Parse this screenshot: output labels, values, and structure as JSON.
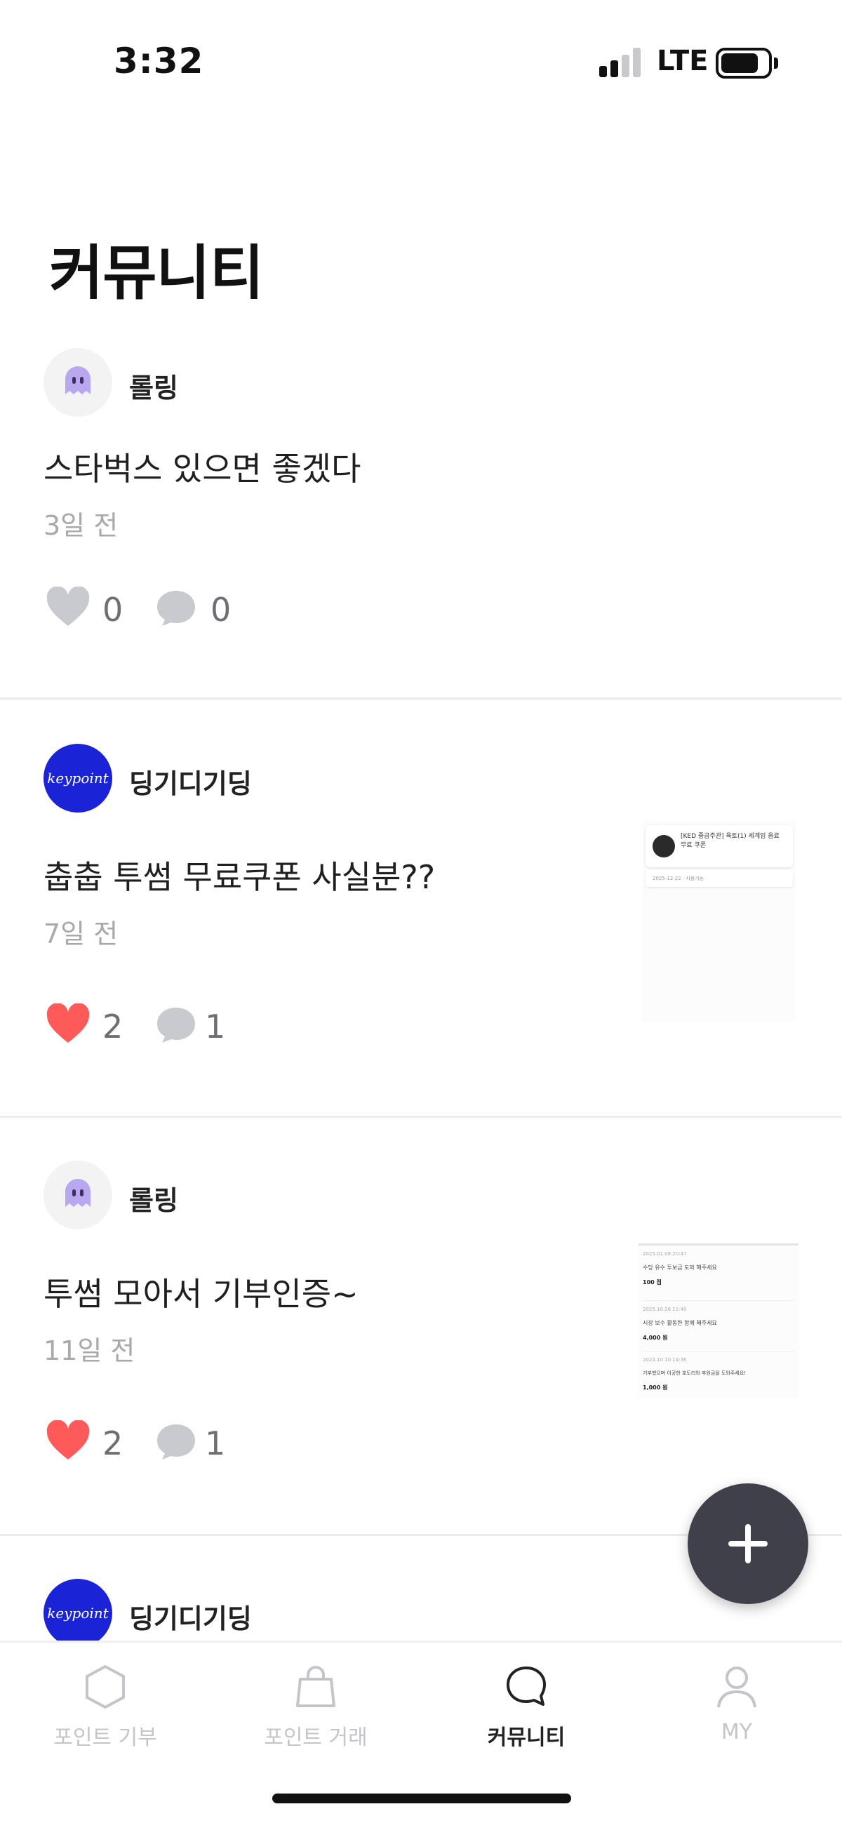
{
  "status_bar": {
    "time": "3:32",
    "network": "LTE"
  },
  "page": {
    "title": "커뮤니티"
  },
  "posts": [
    {
      "author": "롤링",
      "avatar": "ghost-icon",
      "title": "스타벅스 있으면 좋겠다",
      "time": "3일 전",
      "likes": "0",
      "liked": false,
      "comments": "0",
      "has_thumbnail": false
    },
    {
      "author": "딩기디기딩",
      "avatar": "brand-logo",
      "avatar_text": "keypoint",
      "title": "춥춥 투썸 무료쿠폰 사실분??",
      "time": "7일 전",
      "likes": "2",
      "liked": true,
      "comments": "1",
      "has_thumbnail": true
    },
    {
      "author": "롤링",
      "avatar": "ghost-icon",
      "title": "투썸 모아서 기부인증~",
      "time": "11일 전",
      "likes": "2",
      "liked": true,
      "comments": "1",
      "has_thumbnail": true
    },
    {
      "author": "딩기디기딩",
      "avatar": "brand-logo",
      "avatar_text": "keypoint"
    }
  ],
  "thumbnails": {
    "coupon": {
      "item_title": "[KED 중금주관] 육토(1) 세계임 음료 무료 쿠폰",
      "item_sub": "2025-12-22 · 사용가능"
    },
    "donations": [
      {
        "date": "2025.01.08 20:47",
        "desc": "수당 유수 투보급 도와 해주세요",
        "amount": "100 점"
      },
      {
        "date": "2025.10.26 11:40",
        "desc": "시장 보수 활동한 함께 해주세요",
        "amount": "4,000 원"
      },
      {
        "date": "2024.10.10 14:36",
        "desc": "기부했으며 이공한 호도리와 후원금을 도와주세요!",
        "amount": "1,000 원"
      }
    ]
  },
  "tabs": [
    {
      "label": "포인트 기부",
      "icon": "hexagon-icon",
      "active": false
    },
    {
      "label": "포인트 거래",
      "icon": "shopping-bag-icon",
      "active": false
    },
    {
      "label": "커뮤니티",
      "icon": "chat-bubble-icon",
      "active": true
    },
    {
      "label": "MY",
      "icon": "person-icon",
      "active": false
    }
  ],
  "fab": {
    "icon": "plus-icon"
  },
  "colors": {
    "like_active": "#ff5a5a",
    "like_inactive": "#c9cacf",
    "comment": "#c9cacf",
    "fab": "#3f404a",
    "brand_avatar": "#1b23d6",
    "ghost": "#b9a8f0"
  }
}
